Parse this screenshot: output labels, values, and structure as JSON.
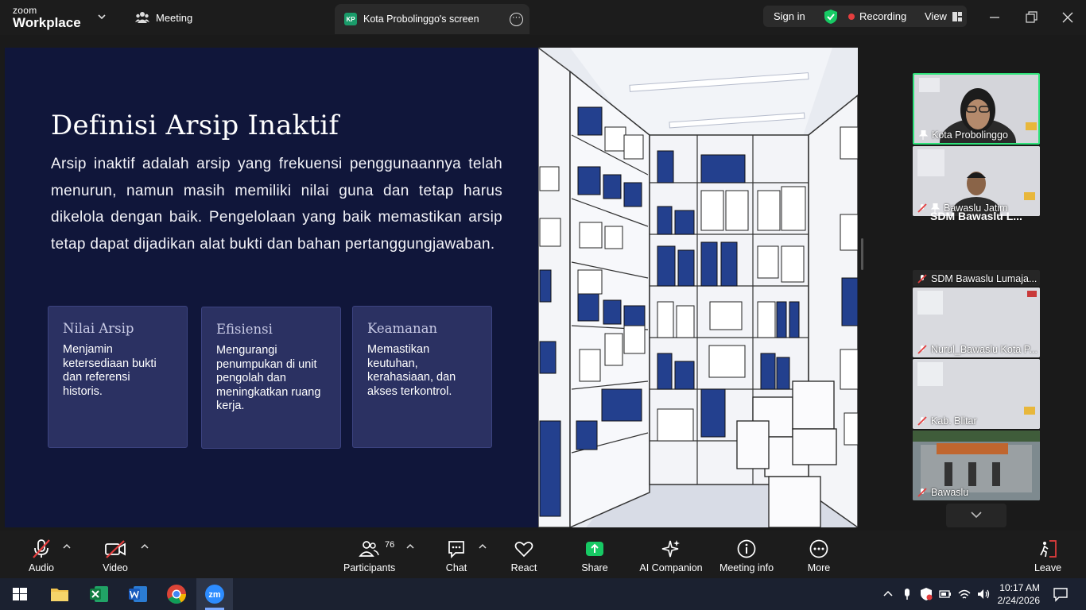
{
  "app": {
    "brand_line1": "zoom",
    "brand_line2": "Workplace"
  },
  "tabs": {
    "meeting": "Meeting",
    "share_initials": "KP",
    "share": "Kota Probolinggo's screen"
  },
  "header": {
    "sign_in": "Sign in",
    "recording": "Recording",
    "view": "View"
  },
  "slide": {
    "title": "Definisi Arsip Inaktif",
    "body": "Arsip inaktif adalah arsip yang frekuensi penggunaannya telah menurun, namun masih memiliki nilai guna dan tetap harus dikelola dengan baik.  Pengelolaan yang baik memastikan arsip tetap dapat dijadikan alat bukti dan bahan pertanggungjawaban.",
    "cards": [
      {
        "title": "Nilai Arsip",
        "text": "Menjamin ketersediaan bukti dan referensi historis."
      },
      {
        "title": "Efisiensi",
        "text": "Mengurangi penumpukan di unit pengolah dan meningkatkan ruang kerja."
      },
      {
        "title": "Keamanan",
        "text": "Memastikan keutuhan, kerahasiaan, dan akses terkontrol."
      }
    ]
  },
  "participants_panel": {
    "tiles": [
      "Kota Probolinggo",
      "Bawaslu Jatim"
    ],
    "name_only": "SDM Bawaslu L...",
    "list": [
      "SDM Bawaslu Lumaja...",
      "Nurul_Bawaslu Kota P...",
      "Kab. Blitar",
      "Bawaslu"
    ]
  },
  "toolbar": {
    "audio": "Audio",
    "video": "Video",
    "participants": "Participants",
    "participant_count": "76",
    "chat": "Chat",
    "react": "React",
    "share": "Share",
    "ai": "AI Companion",
    "info": "Meeting info",
    "more": "More",
    "leave": "Leave"
  },
  "taskbar": {
    "time": "10:17 AM",
    "date": "2/24/2026"
  },
  "colors": {
    "accent_green": "#2ee27a",
    "share_green": "#17c964",
    "rec_red": "#e53e3e",
    "slide_bg": "#10163a",
    "card_bg": "#2b3162"
  }
}
